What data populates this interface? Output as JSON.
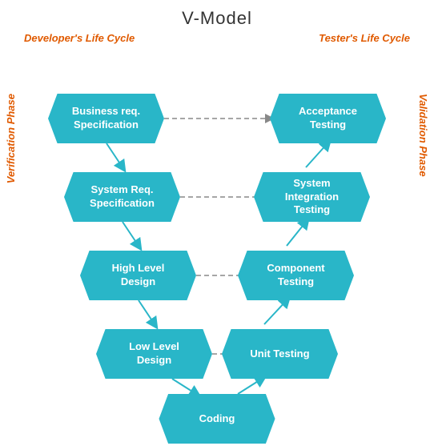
{
  "title": "V-Model",
  "labels": {
    "developer": "Developer's Life Cycle",
    "tester": "Tester's Life Cycle",
    "verification": "Verification Phase",
    "validation": "Validation Phase"
  },
  "boxes": {
    "business": "Business req.\nSpecification",
    "system_req": "System Req.\nSpecification",
    "high_level": "High Level\nDesign",
    "low_level": "Low Level\nDesign",
    "acceptance": "Acceptance\nTesting",
    "system_int": "System\nIntegration\nTesting",
    "component": "Component\nTesting",
    "unit": "Unit Testing",
    "coding": "Coding"
  }
}
